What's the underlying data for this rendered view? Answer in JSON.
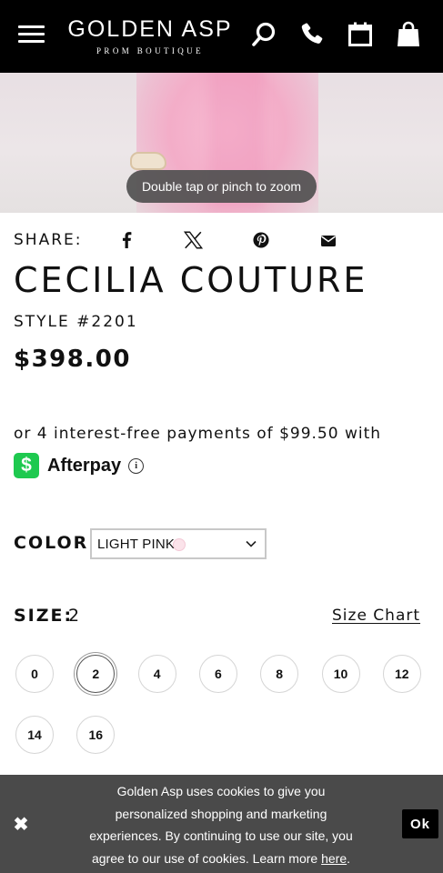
{
  "header": {
    "logo_main": "GOLDEN ASP",
    "logo_sub": "PROM BOUTIQUE",
    "icons": [
      "menu-icon",
      "search-icon",
      "phone-icon",
      "calendar-icon",
      "shopping-bag-icon"
    ]
  },
  "photo": {
    "zoom_hint": "Double tap or pinch to zoom"
  },
  "share": {
    "label": "SHARE:",
    "icons": [
      "facebook-icon",
      "x-twitter-icon",
      "pinterest-icon",
      "email-icon"
    ]
  },
  "product": {
    "title": "CECILIA COUTURE",
    "style": "STYLE #2201",
    "price": "$398.00"
  },
  "afterpay": {
    "installments_text": "or 4 interest-free payments of $99.50 with",
    "brand": "Afterpay",
    "badge_glyph": "$",
    "info_glyph": "i",
    "accent": "#1ec94f"
  },
  "color": {
    "label": "COLOR:",
    "selected": "LIGHT PINK",
    "swatch": "#fbe3ea"
  },
  "size": {
    "label": "SIZE:",
    "selected": "2",
    "chart_link": "Size Chart",
    "options": [
      "0",
      "2",
      "4",
      "6",
      "8",
      "10",
      "12",
      "14",
      "16"
    ]
  },
  "cookie": {
    "text_before": "Golden Asp uses cookies to give you personalized shopping and marketing experiences. By continuing to use our site, you agree to our use of cookies. Learn more ",
    "link": "here",
    "text_after": ".",
    "close_glyph": "✖",
    "ok_label": "Ok"
  }
}
